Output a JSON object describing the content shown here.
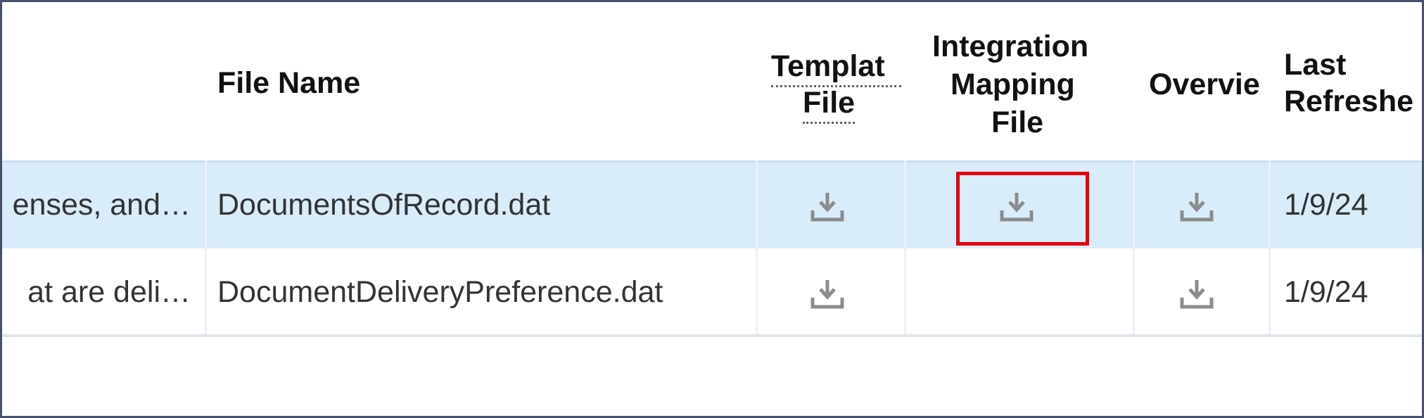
{
  "columns": {
    "file_name": "File Name",
    "template_file_line1": "Templat",
    "template_file_line2": "File",
    "integration_mapping_line1": "Integration",
    "integration_mapping_line2": "Mapping",
    "integration_mapping_line3": "File",
    "overview": "Overvie",
    "last_refreshed_line1": "Last",
    "last_refreshed_line2": "Refreshe"
  },
  "rows": [
    {
      "description": "enses, and…",
      "file_name": "DocumentsOfRecord.dat",
      "template_file_icon": "download-icon",
      "integration_mapping_icon": "download-icon",
      "overview_icon": "download-icon",
      "last_refreshed": "1/9/24",
      "selected": true
    },
    {
      "description": "at are deli…",
      "file_name": "DocumentDeliveryPreference.dat",
      "template_file_icon": "download-icon",
      "integration_mapping_icon": "",
      "overview_icon": "download-icon",
      "last_refreshed": "1/9/24",
      "selected": false
    }
  ],
  "colors": {
    "selected_row": "#d9ecfa",
    "highlight_box": "#e3000f",
    "icon": "#8c8c8c",
    "frame_border": "#46506a"
  }
}
